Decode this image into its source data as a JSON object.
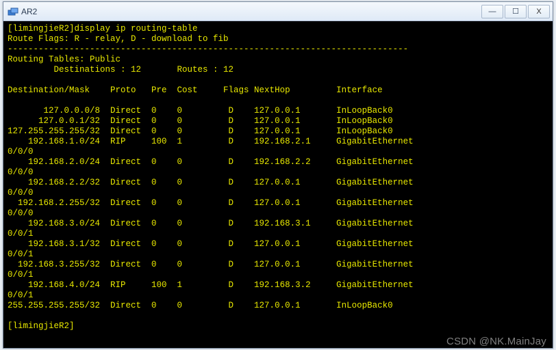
{
  "window": {
    "title": "AR2"
  },
  "terminal": {
    "prompt_host": "limingjieR2",
    "command": "display ip routing-table",
    "flags_line": "Route Flags: R - relay, D - download to fib",
    "tables_line": "Routing Tables: Public",
    "destinations_label": "Destinations :",
    "destinations_value": "12",
    "routes_label": "Routes :",
    "routes_value": "12",
    "headers": {
      "dest": "Destination/Mask",
      "proto": "Proto",
      "pre": "Pre",
      "cost": "Cost",
      "flags": "Flags",
      "nexthop": "NextHop",
      "iface": "Interface"
    },
    "rows": [
      {
        "dest": "127.0.0.0/8",
        "proto": "Direct",
        "pre": "0",
        "cost": "0",
        "flags": "D",
        "nexthop": "127.0.0.1",
        "iface": "InLoopBack0",
        "wrap": ""
      },
      {
        "dest": "127.0.0.1/32",
        "proto": "Direct",
        "pre": "0",
        "cost": "0",
        "flags": "D",
        "nexthop": "127.0.0.1",
        "iface": "InLoopBack0",
        "wrap": ""
      },
      {
        "dest": "127.255.255.255/32",
        "proto": "Direct",
        "pre": "0",
        "cost": "0",
        "flags": "D",
        "nexthop": "127.0.0.1",
        "iface": "InLoopBack0",
        "wrap": ""
      },
      {
        "dest": "192.168.1.0/24",
        "proto": "RIP",
        "pre": "100",
        "cost": "1",
        "flags": "D",
        "nexthop": "192.168.2.1",
        "iface": "GigabitEthernet",
        "wrap": "0/0/0"
      },
      {
        "dest": "192.168.2.0/24",
        "proto": "Direct",
        "pre": "0",
        "cost": "0",
        "flags": "D",
        "nexthop": "192.168.2.2",
        "iface": "GigabitEthernet",
        "wrap": "0/0/0"
      },
      {
        "dest": "192.168.2.2/32",
        "proto": "Direct",
        "pre": "0",
        "cost": "0",
        "flags": "D",
        "nexthop": "127.0.0.1",
        "iface": "GigabitEthernet",
        "wrap": "0/0/0"
      },
      {
        "dest": "192.168.2.255/32",
        "proto": "Direct",
        "pre": "0",
        "cost": "0",
        "flags": "D",
        "nexthop": "127.0.0.1",
        "iface": "GigabitEthernet",
        "wrap": "0/0/0"
      },
      {
        "dest": "192.168.3.0/24",
        "proto": "Direct",
        "pre": "0",
        "cost": "0",
        "flags": "D",
        "nexthop": "192.168.3.1",
        "iface": "GigabitEthernet",
        "wrap": "0/0/1"
      },
      {
        "dest": "192.168.3.1/32",
        "proto": "Direct",
        "pre": "0",
        "cost": "0",
        "flags": "D",
        "nexthop": "127.0.0.1",
        "iface": "GigabitEthernet",
        "wrap": "0/0/1"
      },
      {
        "dest": "192.168.3.255/32",
        "proto": "Direct",
        "pre": "0",
        "cost": "0",
        "flags": "D",
        "nexthop": "127.0.0.1",
        "iface": "GigabitEthernet",
        "wrap": "0/0/1"
      },
      {
        "dest": "192.168.4.0/24",
        "proto": "RIP",
        "pre": "100",
        "cost": "1",
        "flags": "D",
        "nexthop": "192.168.3.2",
        "iface": "GigabitEthernet",
        "wrap": "0/0/1"
      },
      {
        "dest": "255.255.255.255/32",
        "proto": "Direct",
        "pre": "0",
        "cost": "0",
        "flags": "D",
        "nexthop": "127.0.0.1",
        "iface": "InLoopBack0",
        "wrap": ""
      }
    ],
    "end_prompt": "[limingjieR2]"
  },
  "watermark": "CSDN @NK.MainJay"
}
